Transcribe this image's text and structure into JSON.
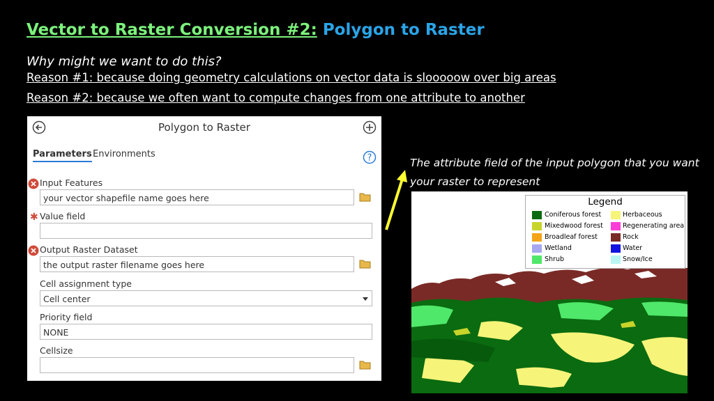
{
  "slide": {
    "title_part1": "Vector to Raster Conversion #2:",
    "title_part2": "Polygon to Raster",
    "question": "Why might we want to do this?",
    "reason1": "Reason #1: because doing geometry calculations on vector data is slooooow over big areas",
    "reason2": "Reason #2: because we often want to compute changes from one attribute to another",
    "annotation": "The attribute field of the input polygon that you want your raster to represent"
  },
  "tool": {
    "title": "Polygon to Raster",
    "tabs": [
      "Parameters",
      "Environments"
    ],
    "input_features_label": "Input Features",
    "input_features_value": "your vector shapefile name goes here",
    "value_field_label": "Value field",
    "value_field_value": "",
    "output_raster_label": "Output Raster Dataset",
    "output_raster_value": "the output raster filename goes here",
    "cell_assignment_label": "Cell assignment type",
    "cell_assignment_value": "Cell center",
    "priority_field_label": "Priority field",
    "priority_field_value": "NONE",
    "cellsize_label": "Cellsize",
    "cellsize_value": ""
  },
  "legend": {
    "title": "Legend",
    "items": [
      {
        "label": "Coniferous forest",
        "color": "#0a6b10"
      },
      {
        "label": "Herbaceous",
        "color": "#f7f47a"
      },
      {
        "label": "Mixedwood forest",
        "color": "#c8d42a"
      },
      {
        "label": "Regenerating area",
        "color": "#ff3ed8"
      },
      {
        "label": "Broadleaf forest",
        "color": "#f5a418"
      },
      {
        "label": "Rock",
        "color": "#7a2a26"
      },
      {
        "label": "Wetland",
        "color": "#a8a8f0"
      },
      {
        "label": "Water",
        "color": "#1414e0"
      },
      {
        "label": "Shrub",
        "color": "#4fe86a"
      },
      {
        "label": "Snow/Ice",
        "color": "#b8f6f4"
      }
    ]
  },
  "colors": {
    "title_green": "#7cf27c",
    "title_blue": "#2aa4e8",
    "arrow": "#ffff33",
    "error_red": "#d04a3a"
  }
}
